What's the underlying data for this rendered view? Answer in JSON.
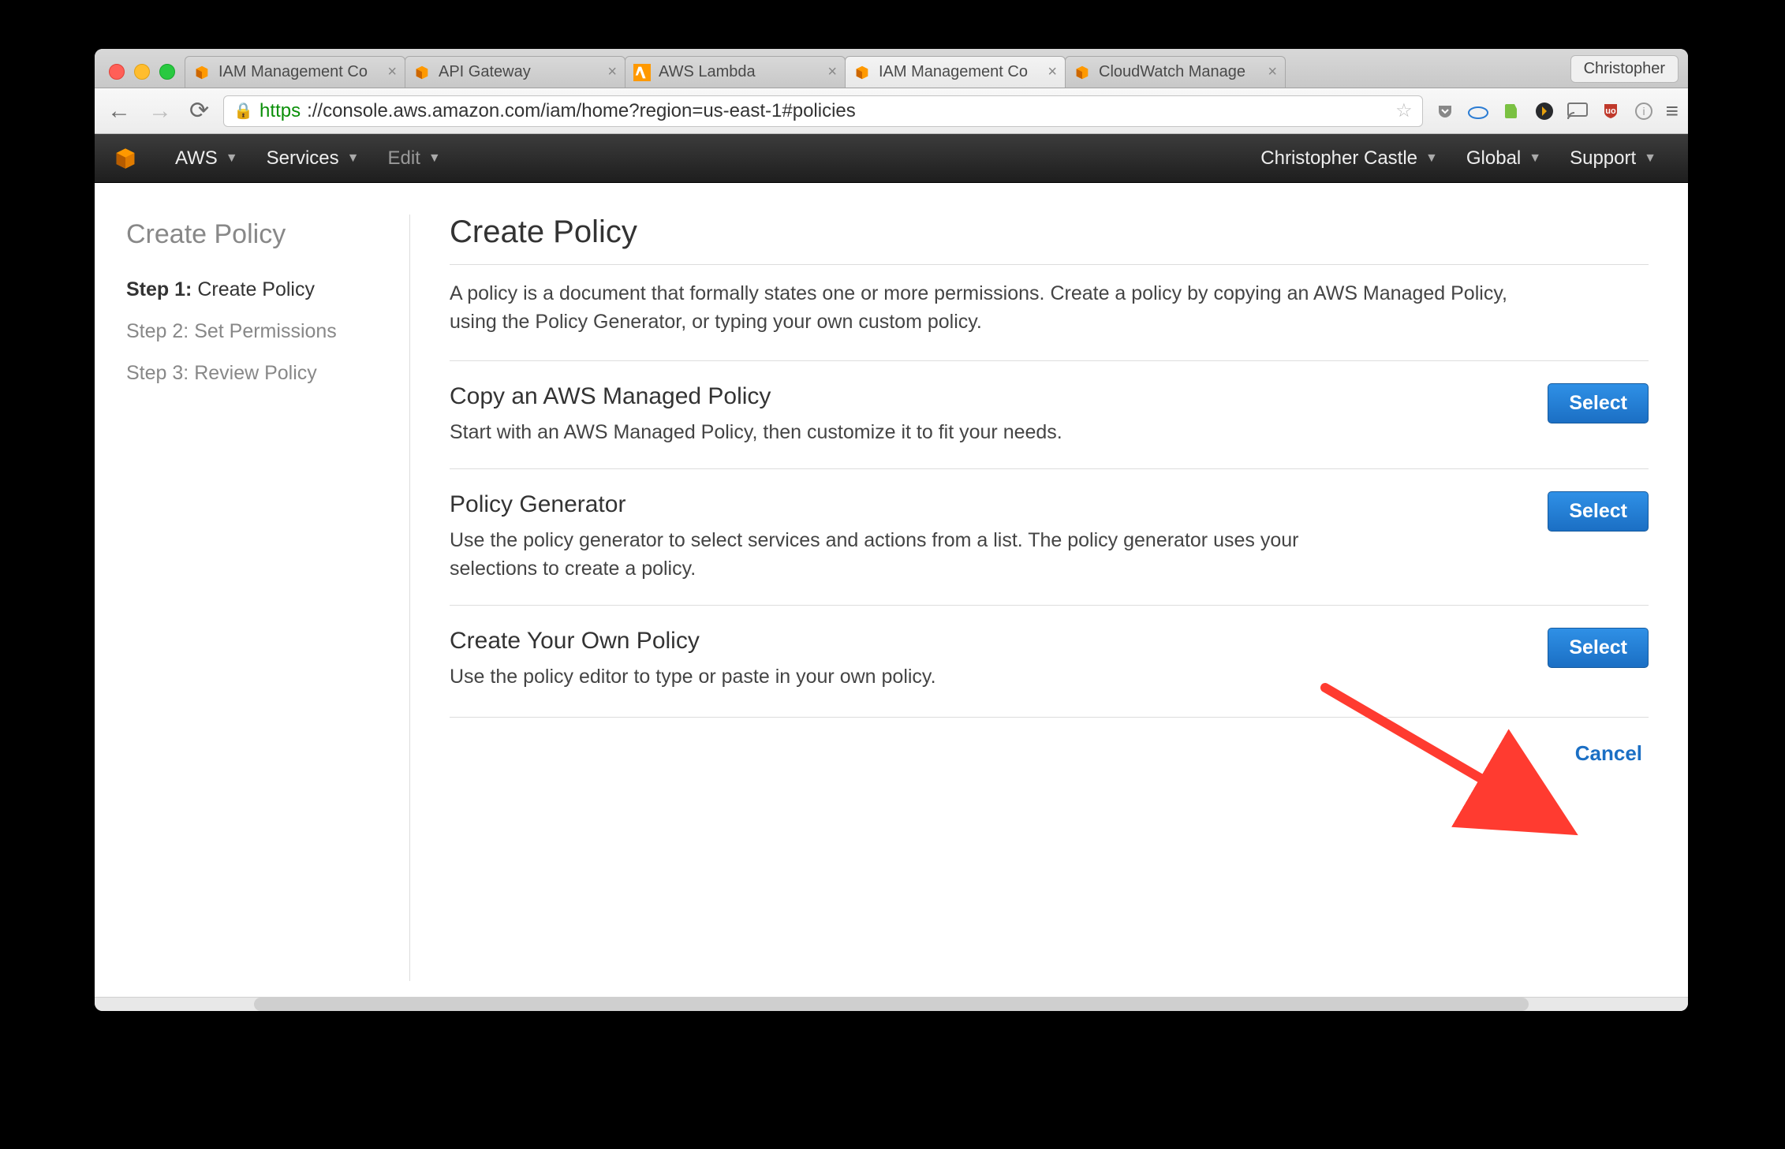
{
  "browser": {
    "profile": "Christopher",
    "tabs": [
      {
        "title": "IAM Management Co",
        "favicon": "aws",
        "active": false
      },
      {
        "title": "API Gateway",
        "favicon": "aws",
        "active": false
      },
      {
        "title": "AWS Lambda",
        "favicon": "lambda",
        "active": false
      },
      {
        "title": "IAM Management Co",
        "favicon": "aws",
        "active": true
      },
      {
        "title": "CloudWatch Manage",
        "favicon": "aws",
        "active": false
      }
    ],
    "url_scheme": "https",
    "url_rest": "://console.aws.amazon.com/iam/home?region=us-east-1#policies"
  },
  "aws_header": {
    "brand": "AWS",
    "services": "Services",
    "edit": "Edit",
    "user": "Christopher Castle",
    "region": "Global",
    "support": "Support"
  },
  "sidebar": {
    "title": "Create Policy",
    "steps": [
      {
        "label": "Step 1:",
        "name": "Create Policy",
        "active": true
      },
      {
        "label": "Step 2:",
        "name": "Set Permissions",
        "active": false
      },
      {
        "label": "Step 3:",
        "name": "Review Policy",
        "active": false
      }
    ]
  },
  "main": {
    "title": "Create Policy",
    "intro": "A policy is a document that formally states one or more permissions. Create a policy by copying an AWS Managed Policy, using the Policy Generator, or typing your own custom policy.",
    "options": [
      {
        "heading": "Copy an AWS Managed Policy",
        "desc": "Start with an AWS Managed Policy, then customize it to fit your needs.",
        "button": "Select"
      },
      {
        "heading": "Policy Generator",
        "desc": "Use the policy generator to select services and actions from a list. The policy generator uses your selections to create a policy.",
        "button": "Select"
      },
      {
        "heading": "Create Your Own Policy",
        "desc": "Use the policy editor to type or paste in your own policy.",
        "button": "Select"
      }
    ],
    "cancel": "Cancel"
  }
}
